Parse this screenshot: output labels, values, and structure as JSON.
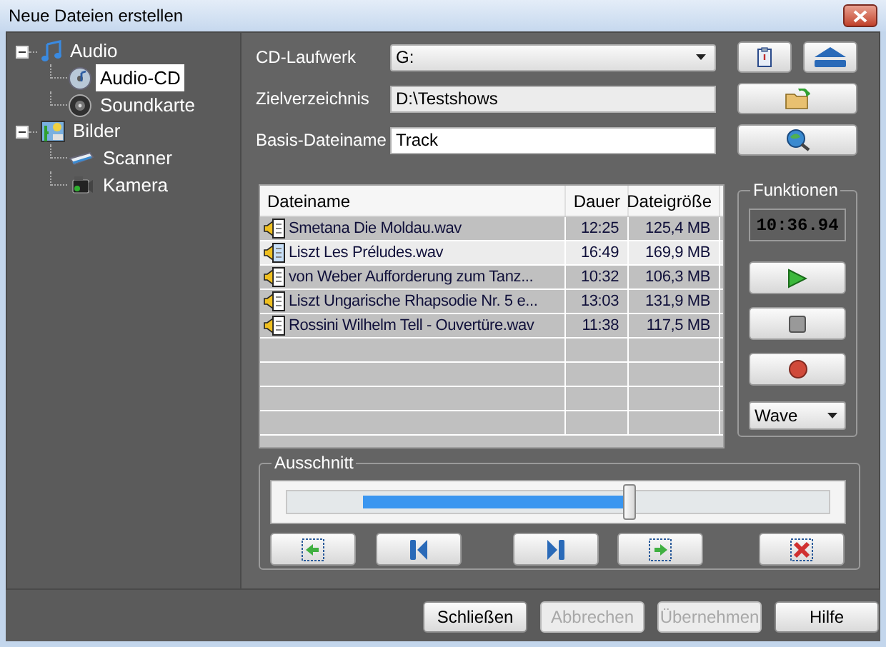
{
  "window": {
    "title": "Neue Dateien erstellen"
  },
  "tree": [
    {
      "label": "Audio",
      "expanded": true,
      "selected": false,
      "children": [
        {
          "label": "Audio-CD",
          "selected": true
        },
        {
          "label": "Soundkarte",
          "selected": false
        }
      ]
    },
    {
      "label": "Bilder",
      "expanded": true,
      "selected": false,
      "children": [
        {
          "label": "Scanner",
          "selected": false
        },
        {
          "label": "Kamera",
          "selected": false
        }
      ]
    }
  ],
  "form": {
    "cd_drive": {
      "label": "CD-Laufwerk",
      "value": "G:"
    },
    "target_dir": {
      "label": "Zielverzeichnis",
      "value": "D:\\Testshows"
    },
    "base_name": {
      "label": "Basis-Dateiname",
      "value": "Track"
    }
  },
  "table": {
    "columns": [
      "Dateiname",
      "Dauer",
      "Dateigröße"
    ],
    "rows": [
      {
        "cells": [
          "Smetana Die Moldau.wav",
          "12:25",
          "125,4 MB"
        ],
        "selected": false
      },
      {
        "cells": [
          "Liszt Les Préludes.wav",
          "16:49",
          "169,9 MB"
        ],
        "selected": true
      },
      {
        "cells": [
          "von Weber Aufforderung zum Tanz...",
          "10:32",
          "106,3 MB"
        ],
        "selected": false
      },
      {
        "cells": [
          "Liszt Ungarische Rhapsodie Nr. 5 e...",
          "13:03",
          "131,9 MB"
        ],
        "selected": false
      },
      {
        "cells": [
          "Rossini Wilhelm Tell - Ouvertüre.wav",
          "11:38",
          "117,5 MB"
        ],
        "selected": false
      }
    ]
  },
  "functions": {
    "title": "Funktionen",
    "timer": "10:36.94",
    "format": "Wave"
  },
  "selection": {
    "title": "Ausschnitt",
    "range_start": {
      "level": 0.14
    },
    "thumb": {
      "level": 0.63
    }
  },
  "buttons": [
    {
      "label": "Schließen",
      "disabled": false
    },
    {
      "label": "Abbrechen",
      "disabled": true
    },
    {
      "label": "Übernehmen",
      "disabled": true
    },
    {
      "label": "Hilfe",
      "disabled": false
    }
  ]
}
